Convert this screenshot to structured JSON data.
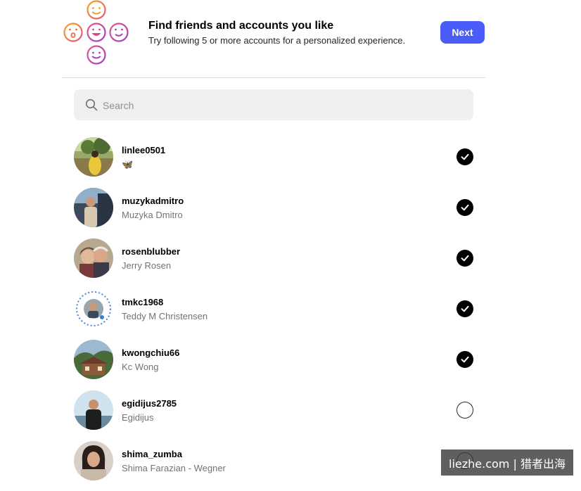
{
  "header": {
    "title": "Find friends and accounts you like",
    "subtitle": "Try following 5 or more accounts for a personalized experience.",
    "next_label": "Next",
    "logo_icon": "smiley-cluster-icon"
  },
  "search": {
    "placeholder": "Search",
    "value": ""
  },
  "accounts": [
    {
      "username": "linlee0501",
      "full_name": "🦋",
      "selected": true
    },
    {
      "username": "muzykadmitro",
      "full_name": "Muzyka Dmitro",
      "selected": true
    },
    {
      "username": "rosenblubber",
      "full_name": "Jerry Rosen",
      "selected": true
    },
    {
      "username": "tmkc1968",
      "full_name": "Teddy M Christensen",
      "selected": true
    },
    {
      "username": "kwongchiu66",
      "full_name": "Kc Wong",
      "selected": true
    },
    {
      "username": "egidijus2785",
      "full_name": "Egidijus",
      "selected": false
    },
    {
      "username": "shima_zumba",
      "full_name": "Shima Farazian - Wegner",
      "selected": false
    }
  ],
  "watermark": "liezhe.com | 猎者出海",
  "colors": {
    "accent": "#4a5df9",
    "divider": "#dbdbdb",
    "search_bg": "#efefef",
    "secondary_text": "#737373"
  }
}
